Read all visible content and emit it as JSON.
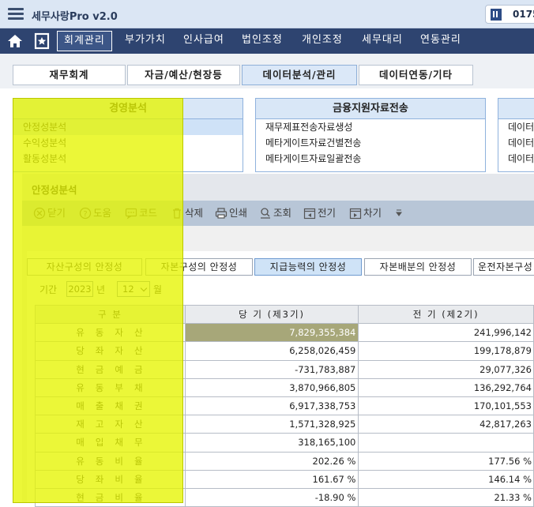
{
  "app": {
    "title": "세무사랑Pro v2.0",
    "user_id": "0175"
  },
  "nav": {
    "items": [
      "회계관리",
      "부가가치",
      "인사급여",
      "법인조정",
      "개인조정",
      "세무대리",
      "연동관리"
    ]
  },
  "subtabs": [
    "재무회계",
    "자금/예산/현장등",
    "데이터분석/관리",
    "데이터연동/기타"
  ],
  "panels": [
    {
      "title": "경영분석",
      "items": [
        "안정성분석",
        "수익성분석",
        "활동성분석"
      ]
    },
    {
      "title": "금융지원자료전송",
      "items": [
        "재무제표전송자료생성",
        "메타게이트자료건별전송",
        "메타게이트자료일괄전송"
      ]
    },
    {
      "title": "",
      "items": [
        "데이터",
        "데이터",
        "데이터"
      ]
    }
  ],
  "window": {
    "title": "안정성분석",
    "toolbar": [
      "닫기",
      "도움",
      "코드",
      "삭제",
      "인쇄",
      "조회",
      "전기",
      "차기"
    ],
    "tabs": [
      "자산구성의 안정성",
      "자본구성의 안정성",
      "지급능력의 안정성",
      "자본배분의 안정성",
      "운전자본구성"
    ],
    "period_label": "기간",
    "year": "2023",
    "year_unit": "년",
    "month": "12",
    "month_unit": "월",
    "table": {
      "headers": [
        "구 분",
        "당   기 (제3기)",
        "전   기 (제2기)"
      ],
      "rows": [
        {
          "label": "유동자산",
          "cur": "7,829,355,384",
          "prev": "241,996,142"
        },
        {
          "label": "당좌자산",
          "cur": "6,258,026,459",
          "prev": "199,178,879"
        },
        {
          "label": "현금예금",
          "cur": "-731,783,887",
          "prev": "29,077,326"
        },
        {
          "label": "유동부채",
          "cur": "3,870,966,805",
          "prev": "136,292,764"
        },
        {
          "label": "매출채권",
          "cur": "6,917,338,753",
          "prev": "170,101,553"
        },
        {
          "label": "재고자산",
          "cur": "1,571,328,925",
          "prev": "42,817,263"
        },
        {
          "label": "매입채무",
          "cur": "318,165,100",
          "prev": ""
        },
        {
          "label": "유동비율",
          "cur": "202.26 %",
          "prev": "177.56 %"
        },
        {
          "label": "당좌비율",
          "cur": "161.67 %",
          "prev": "146.14 %"
        },
        {
          "label": "현금비율",
          "cur": "-18.90 %",
          "prev": "21.33 %"
        }
      ]
    }
  },
  "colors": {
    "nav_bg": "#2e4470",
    "highlight": "#e6f500",
    "selected_cell": "#a7a779"
  }
}
